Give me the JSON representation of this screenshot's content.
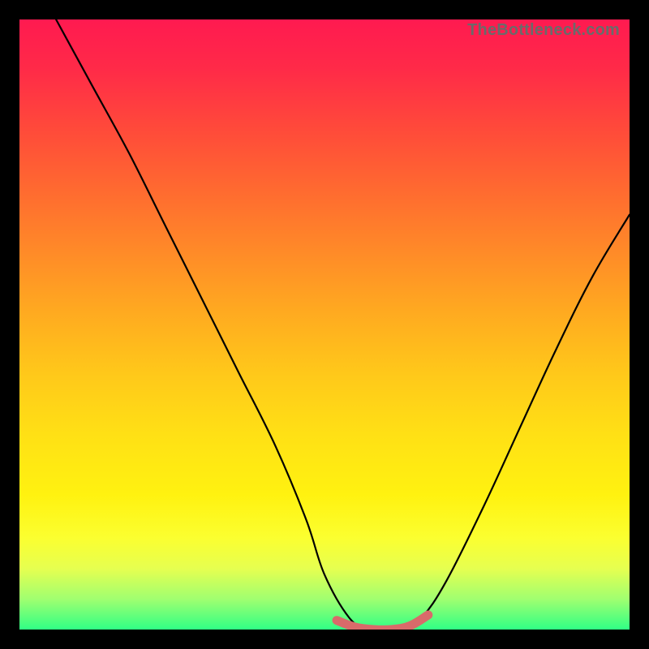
{
  "watermark": "TheBottleneck.com",
  "colors": {
    "frame": "#000000",
    "curve_stroke": "#000000",
    "highlight_stroke": "#d96a6a",
    "gradient_top": "#ff1a50",
    "gradient_bottom": "#30ff85"
  },
  "chart_data": {
    "type": "line",
    "title": "",
    "xlabel": "",
    "ylabel": "",
    "xlim": [
      0,
      100
    ],
    "ylim": [
      0,
      100
    ],
    "series": [
      {
        "name": "bottleneck-curve",
        "x": [
          6,
          12,
          18,
          24,
          30,
          36,
          42,
          47,
          50,
          54,
          57,
          60,
          63,
          66,
          70,
          76,
          82,
          88,
          94,
          100
        ],
        "y": [
          100,
          89,
          78,
          66,
          54,
          42,
          30,
          18,
          9,
          2,
          0,
          0,
          0,
          2,
          8,
          20,
          33,
          46,
          58,
          68
        ]
      },
      {
        "name": "optimal-range-highlight",
        "x": [
          52,
          55,
          58,
          61,
          64,
          67
        ],
        "y": [
          1.5,
          0.4,
          0,
          0,
          0.6,
          2.4
        ]
      }
    ],
    "grid": false,
    "legend": false
  }
}
